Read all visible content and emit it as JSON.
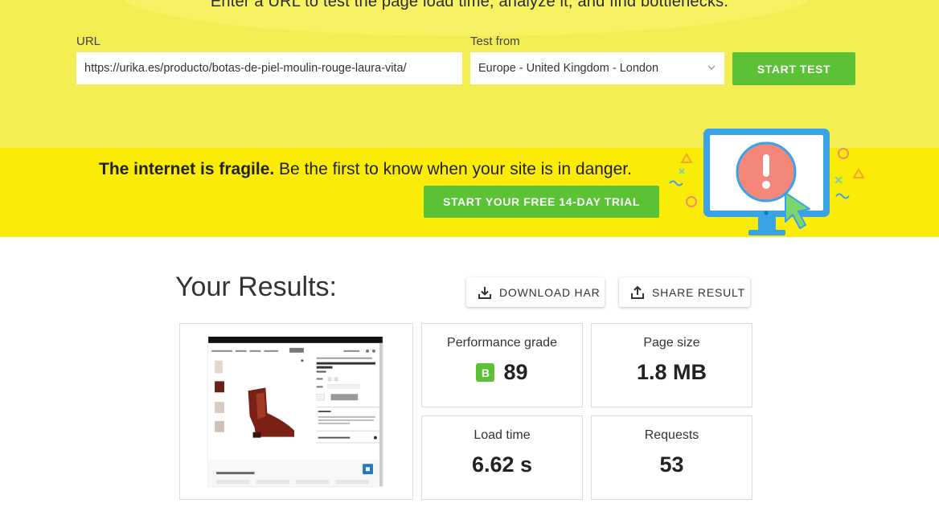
{
  "hero": {
    "tagline": "Enter a URL to test the page load time, analyze it, and find bottlenecks.",
    "url_label": "URL",
    "url_value": "https://urika.es/producto/botas-de-piel-moulin-rouge-laura-vita/",
    "test_from_label": "Test from",
    "test_from_value": "Europe - United Kingdom - London",
    "start_test_label": "START TEST"
  },
  "banner": {
    "bold_text": "The internet is fragile.",
    "text": " Be the first to know when your site is in danger.",
    "trial_label": "START YOUR FREE 14-DAY TRIAL"
  },
  "results": {
    "title": "Your Results:",
    "download_label": "DOWNLOAD HAR",
    "share_label": "SHARE RESULT",
    "metrics": {
      "performance": {
        "label": "Performance grade",
        "grade": "B",
        "value": "89"
      },
      "page_size": {
        "label": "Page size",
        "value": "1.8 MB"
      },
      "load_time": {
        "label": "Load time",
        "value": "6.62 s"
      },
      "requests": {
        "label": "Requests",
        "value": "53"
      }
    }
  },
  "colors": {
    "hero_bg": "#f2ed52",
    "banner_bg": "#fbec07",
    "accent_green": "#5bc236",
    "monitor_blue": "#3aa3e8",
    "alert_red": "#f4877a"
  }
}
